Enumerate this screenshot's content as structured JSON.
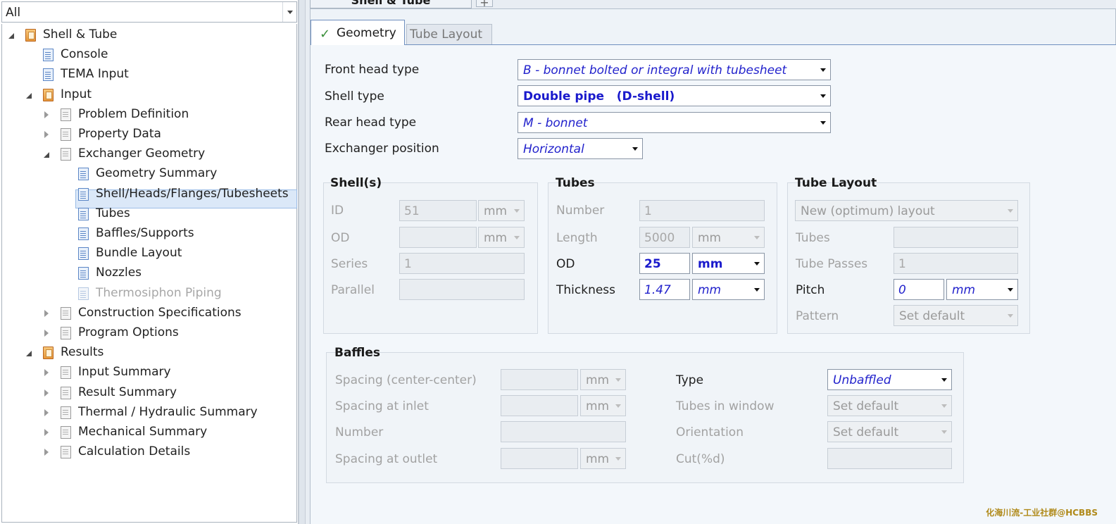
{
  "filter": {
    "value": "All"
  },
  "tree": [
    {
      "label": "Shell & Tube",
      "icon": "folder-icon",
      "expander": "open",
      "dim": false
    },
    {
      "label": "Console",
      "icon": "doc-icon",
      "expander": "none",
      "dim": false
    },
    {
      "label": "TEMA Input",
      "icon": "doc-icon",
      "expander": "none",
      "dim": false
    },
    {
      "label": "Input",
      "icon": "folder-icon",
      "expander": "open",
      "dim": false
    },
    {
      "label": "Problem Definition",
      "icon": "page-icon",
      "expander": "closed",
      "dim": false
    },
    {
      "label": "Property Data",
      "icon": "page-icon",
      "expander": "closed",
      "dim": false
    },
    {
      "label": "Exchanger Geometry",
      "icon": "page-icon",
      "expander": "open",
      "dim": false
    },
    {
      "label": "Geometry Summary",
      "icon": "doc-icon",
      "expander": "none",
      "dim": false,
      "selected": true
    },
    {
      "label": "Shell/Heads/Flanges/Tubesheets",
      "icon": "doc-icon",
      "expander": "none",
      "dim": false
    },
    {
      "label": "Tubes",
      "icon": "doc-icon",
      "expander": "none",
      "dim": false
    },
    {
      "label": "Baffles/Supports",
      "icon": "doc-icon",
      "expander": "none",
      "dim": false
    },
    {
      "label": "Bundle Layout",
      "icon": "doc-icon",
      "expander": "none",
      "dim": false
    },
    {
      "label": "Nozzles",
      "icon": "doc-icon",
      "expander": "none",
      "dim": false
    },
    {
      "label": "Thermosiphon Piping",
      "icon": "doc-icon",
      "expander": "none",
      "dim": true
    },
    {
      "label": "Construction Specifications",
      "icon": "page-icon",
      "expander": "closed",
      "dim": false
    },
    {
      "label": "Program Options",
      "icon": "page-icon",
      "expander": "closed",
      "dim": false
    },
    {
      "label": "Results",
      "icon": "folder-icon",
      "expander": "open",
      "dim": false
    },
    {
      "label": "Input Summary",
      "icon": "page-icon",
      "expander": "closed",
      "dim": false
    },
    {
      "label": "Result Summary",
      "icon": "page-icon",
      "expander": "closed",
      "dim": false
    },
    {
      "label": "Thermal / Hydraulic Summary",
      "icon": "page-icon",
      "expander": "closed",
      "dim": false
    },
    {
      "label": "Mechanical Summary",
      "icon": "page-icon",
      "expander": "closed",
      "dim": false
    },
    {
      "label": "Calculation Details",
      "icon": "page-icon",
      "expander": "closed",
      "dim": false
    }
  ],
  "document_tab": {
    "label": "Shell & Tube",
    "plus": "+"
  },
  "tabs": {
    "geometry": "Geometry",
    "geometry_check": "✓",
    "tube_layout": "Tube Layout"
  },
  "head": {
    "front_label": "Front head type",
    "front_value": "B - bonnet bolted or integral with tubesheet",
    "shell_label": "Shell type",
    "shell_value": "Double pipe   (D-shell)",
    "rear_label": "Rear head type",
    "rear_value": "M - bonnet",
    "position_label": "Exchanger position",
    "position_value": "Horizontal"
  },
  "shells": {
    "title": "Shell(s)",
    "id_label": "ID",
    "id_value": "51",
    "id_unit": "mm",
    "od_label": "OD",
    "od_value": "",
    "od_unit": "mm",
    "series_label": "Series",
    "series_value": "1",
    "parallel_label": "Parallel",
    "parallel_value": ""
  },
  "tubes": {
    "title": "Tubes",
    "number_label": "Number",
    "number_value": "1",
    "length_label": "Length",
    "length_value": "5000",
    "length_unit": "mm",
    "od_label": "OD",
    "od_value": "25",
    "od_unit": "mm",
    "thickness_label": "Thickness",
    "thickness_value": "1.47",
    "thickness_unit": "mm"
  },
  "tube_layout": {
    "title": "Tube Layout",
    "layout_value": "New (optimum) layout",
    "tubes_label": "Tubes",
    "tubes_value": "",
    "passes_label": "Tube Passes",
    "passes_value": "1",
    "pitch_label": "Pitch",
    "pitch_value": "0",
    "pitch_unit": "mm",
    "pattern_label": "Pattern",
    "pattern_value": "Set default"
  },
  "baffles": {
    "title": "Baffles",
    "spacing_cc_label": "Spacing (center-center)",
    "spacing_cc_value": "",
    "spacing_cc_unit": "mm",
    "spacing_inlet_label": "Spacing at inlet",
    "spacing_inlet_value": "",
    "spacing_inlet_unit": "mm",
    "number_label": "Number",
    "number_value": "",
    "spacing_outlet_label": "Spacing at outlet",
    "spacing_outlet_value": "",
    "spacing_outlet_unit": "mm",
    "type_label": "Type",
    "type_value": "Unbaffled",
    "tubes_window_label": "Tubes in window",
    "tubes_window_value": "Set default",
    "orientation_label": "Orientation",
    "orientation_value": "Set default",
    "cut_label": "Cut(%d)",
    "cut_value": ""
  },
  "watermark": "化海川流-工业社群@HCBBS"
}
